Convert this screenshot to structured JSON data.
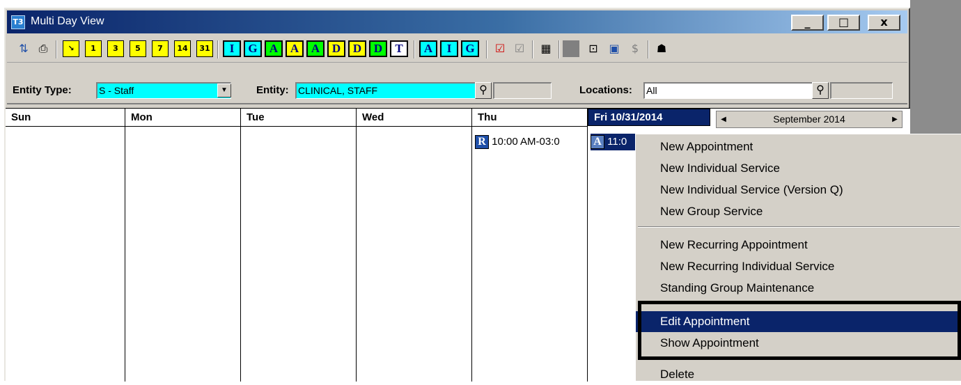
{
  "window": {
    "title": "Multi Day View",
    "app_icon": "T3",
    "minimize": "_",
    "maximize": "□",
    "close": "x"
  },
  "toolbar": {
    "refresh_icon": "refresh-icon",
    "print_icon": "printer-icon",
    "days": [
      {
        "label": "1"
      },
      {
        "label": "3"
      },
      {
        "label": "5"
      },
      {
        "label": "7"
      },
      {
        "label": "14"
      },
      {
        "label": "31"
      }
    ],
    "letters": [
      {
        "label": "I",
        "color": "#00ffff"
      },
      {
        "label": "G",
        "color": "#00ffff"
      },
      {
        "label": "A",
        "color": "#00ff00"
      },
      {
        "label": "A",
        "color": "#ffff00"
      },
      {
        "label": "A",
        "color": "#00ff00"
      },
      {
        "label": "D",
        "color": "#ffff00"
      },
      {
        "label": "D",
        "color": "#ffff00"
      },
      {
        "label": "D",
        "color": "#00ff00"
      },
      {
        "label": "T",
        "color": "#ffffff"
      },
      {
        "label": "A",
        "color": "#00ffff"
      },
      {
        "label": "I",
        "color": "#00ffff"
      },
      {
        "label": "G",
        "color": "#00ffff"
      }
    ]
  },
  "filters": {
    "entity_type_label": "Entity Type:",
    "entity_type_value": "S - Staff",
    "entity_label": "Entity:",
    "entity_value": "CLINICAL, STAFF",
    "locations_label": "Locations:",
    "locations_value": "All"
  },
  "calendar": {
    "days": [
      "Sun",
      "Mon",
      "Tue",
      "Wed",
      "Thu"
    ],
    "selected_day": "Fri 10/31/2014",
    "month_nav": "September 2014",
    "appointments": [
      {
        "badge": "R",
        "text": "10:00 AM-03:0"
      },
      {
        "badge": "A",
        "text": "11:0"
      }
    ]
  },
  "context_menu": {
    "group1": [
      "New Appointment",
      "New Individual Service",
      "New Individual Service (Version Q)",
      "New Group Service"
    ],
    "group2": [
      "New Recurring Appointment",
      "New Recurring Individual Service",
      "Standing Group Maintenance"
    ],
    "group3": [
      "Edit Appointment",
      "Show Appointment"
    ],
    "group4": [
      "Delete"
    ]
  }
}
